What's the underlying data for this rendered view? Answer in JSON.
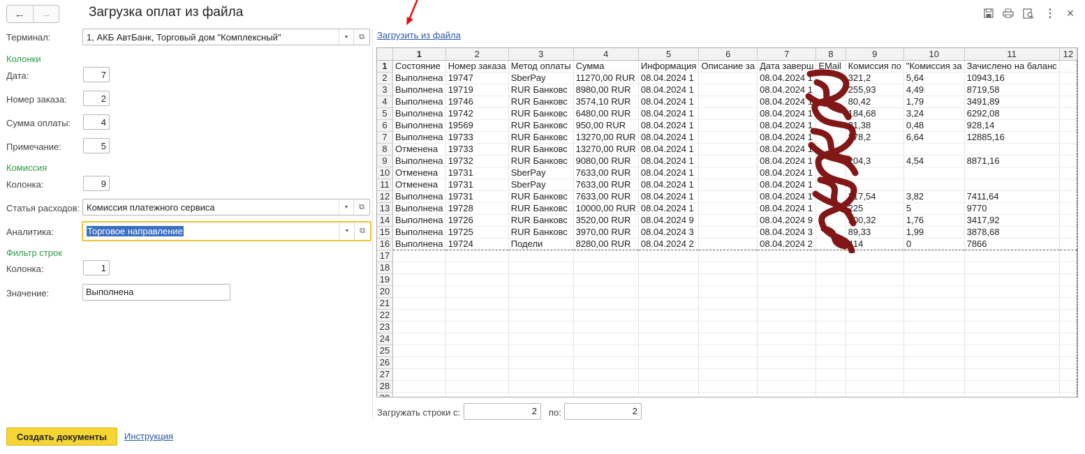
{
  "header": {
    "title": "Загрузка оплат из файла",
    "back_icon": "←",
    "forward_icon": "→",
    "icons": [
      "save-icon",
      "print-icon",
      "preview-icon",
      "more-icon",
      "close-icon"
    ]
  },
  "form": {
    "terminal_label": "Терминал:",
    "terminal_value": "1, АКБ АвтБанк, Торговый дом \"Комплексный\"",
    "columns_section": "Колонки",
    "date_label": "Дата:",
    "date_value": "7",
    "order_label": "Номер заказа:",
    "order_value": "2",
    "sum_label": "Сумма оплаты:",
    "sum_value": "4",
    "note_label": "Примечание:",
    "note_value": "5",
    "commission_section": "Комиссия",
    "commission_col_label": "Колонка:",
    "commission_col_value": "9",
    "expense_label": "Статья расходов:",
    "expense_value": "Комиссия платежного сервиса",
    "analytics_label": "Аналитика:",
    "analytics_value": "Торговое направление",
    "filter_section": "Фильтр строк",
    "filter_col_label": "Колонка:",
    "filter_col_value": "1",
    "filter_value_label": "Значение:",
    "filter_value": "Выполнена"
  },
  "footer": {
    "create_button": "Создать документы",
    "instruction_link": "Инструкция"
  },
  "sheet": {
    "load_link": "Загрузить из файла",
    "col_headers": [
      "1",
      "2",
      "3",
      "4",
      "5",
      "6",
      "7",
      "8",
      "9",
      "10",
      "11",
      "12"
    ],
    "rows": [
      {
        "n": "1",
        "c": [
          "Состояние",
          "Номер заказа",
          "Метод оплаты",
          "Сумма",
          "Информация",
          "Описание за",
          "Дата заверш",
          "EMail",
          "Комиссия по",
          "\"Комиссия за",
          "Зачислено на баланс",
          ""
        ]
      },
      {
        "n": "2",
        "c": [
          "Выполнена",
          "19747",
          "SberPay",
          "11270,00 RUR",
          "08.04.2024 1",
          "",
          "08.04.2024 1",
          "",
          "321,2",
          "5,64",
          "10943,16",
          ""
        ]
      },
      {
        "n": "3",
        "c": [
          "Выполнена",
          "19719",
          "RUR Банковс",
          "8980,00 RUR",
          "08.04.2024 1",
          "",
          "08.04.2024 1",
          "",
          "255,93",
          "4,49",
          "8719,58",
          ""
        ]
      },
      {
        "n": "4",
        "c": [
          "Выполнена",
          "19746",
          "RUR Банковс",
          "3574,10 RUR",
          "08.04.2024 1",
          "",
          "08.04.2024 1",
          "",
          "80,42",
          "1,79",
          "3491,89",
          ""
        ]
      },
      {
        "n": "5",
        "c": [
          "Выполнена",
          "19742",
          "RUR Банковс",
          "6480,00 RUR",
          "08.04.2024 1",
          "",
          "08.04.2024 1",
          "",
          "184,68",
          "3,24",
          "6292,08",
          ""
        ]
      },
      {
        "n": "6",
        "c": [
          "Выполнена",
          "19569",
          "RUR Банковс",
          "950,00 RUR",
          "08.04.2024 1",
          "",
          "08.04.2024 1",
          "",
          "21,38",
          "0,48",
          "928,14",
          ""
        ]
      },
      {
        "n": "7",
        "c": [
          "Выполнена",
          "19733",
          "RUR Банковс",
          "13270,00 RUR",
          "08.04.2024 1",
          "",
          "08.04.2024 1",
          "",
          "378,2",
          "6,64",
          "12885,16",
          ""
        ]
      },
      {
        "n": "8",
        "c": [
          "Отменена",
          "19733",
          "RUR Банковс",
          "13270,00 RUR",
          "08.04.2024 1",
          "",
          "08.04.2024 1",
          "",
          "",
          "",
          "",
          ""
        ]
      },
      {
        "n": "9",
        "c": [
          "Выполнена",
          "19732",
          "RUR Банковс",
          "9080,00 RUR",
          "08.04.2024 1",
          "",
          "08.04.2024 1",
          "",
          "204,3",
          "4,54",
          "8871,16",
          ""
        ]
      },
      {
        "n": "10",
        "c": [
          "Отменена",
          "19731",
          "SberPay",
          "7633,00 RUR",
          "08.04.2024 1",
          "",
          "08.04.2024 1",
          "",
          "",
          "",
          "",
          ""
        ]
      },
      {
        "n": "11",
        "c": [
          "Отменена",
          "19731",
          "SberPay",
          "7633,00 RUR",
          "08.04.2024 1",
          "",
          "08.04.2024 1",
          "",
          "",
          "",
          "",
          ""
        ]
      },
      {
        "n": "12",
        "c": [
          "Выполнена",
          "19731",
          "RUR Банковс",
          "7633,00 RUR",
          "08.04.2024 1",
          "",
          "08.04.2024 1",
          "",
          "217,54",
          "3,82",
          "7411,64",
          ""
        ]
      },
      {
        "n": "13",
        "c": [
          "Выполнена",
          "19728",
          "RUR Банковс",
          "10000,00 RUR",
          "08.04.2024 1",
          "",
          "08.04.2024 1",
          "",
          "225",
          "5",
          "9770",
          ""
        ]
      },
      {
        "n": "14",
        "c": [
          "Выполнена",
          "19726",
          "RUR Банковс",
          "3520,00 RUR",
          "08.04.2024 9",
          "",
          "08.04.2024 9",
          "",
          "100,32",
          "1,76",
          "3417,92",
          ""
        ]
      },
      {
        "n": "15",
        "c": [
          "Выполнена",
          "19725",
          "RUR Банковс",
          "3970,00 RUR",
          "08.04.2024 3",
          "",
          "08.04.2024 3",
          "",
          "89,33",
          "1,99",
          "3878,68",
          ""
        ]
      },
      {
        "n": "16",
        "c": [
          "Выполнена",
          "19724",
          "Подели",
          "8280,00 RUR",
          "08.04.2024 2",
          "",
          "08.04.2024 2",
          "",
          "414",
          "0",
          "7866",
          ""
        ]
      },
      {
        "n": "17",
        "c": [
          "",
          "",
          "",
          "",
          "",
          "",
          "",
          "",
          "",
          "",
          "",
          ""
        ]
      },
      {
        "n": "18",
        "c": [
          "",
          "",
          "",
          "",
          "",
          "",
          "",
          "",
          "",
          "",
          "",
          ""
        ]
      },
      {
        "n": "19",
        "c": [
          "",
          "",
          "",
          "",
          "",
          "",
          "",
          "",
          "",
          "",
          "",
          ""
        ]
      },
      {
        "n": "20",
        "c": [
          "",
          "",
          "",
          "",
          "",
          "",
          "",
          "",
          "",
          "",
          "",
          ""
        ]
      },
      {
        "n": "21",
        "c": [
          "",
          "",
          "",
          "",
          "",
          "",
          "",
          "",
          "",
          "",
          "",
          ""
        ]
      },
      {
        "n": "22",
        "c": [
          "",
          "",
          "",
          "",
          "",
          "",
          "",
          "",
          "",
          "",
          "",
          ""
        ]
      },
      {
        "n": "23",
        "c": [
          "",
          "",
          "",
          "",
          "",
          "",
          "",
          "",
          "",
          "",
          "",
          ""
        ]
      },
      {
        "n": "24",
        "c": [
          "",
          "",
          "",
          "",
          "",
          "",
          "",
          "",
          "",
          "",
          "",
          ""
        ]
      },
      {
        "n": "25",
        "c": [
          "",
          "",
          "",
          "",
          "",
          "",
          "",
          "",
          "",
          "",
          "",
          ""
        ]
      },
      {
        "n": "26",
        "c": [
          "",
          "",
          "",
          "",
          "",
          "",
          "",
          "",
          "",
          "",
          "",
          ""
        ]
      },
      {
        "n": "27",
        "c": [
          "",
          "",
          "",
          "",
          "",
          "",
          "",
          "",
          "",
          "",
          "",
          ""
        ]
      },
      {
        "n": "28",
        "c": [
          "",
          "",
          "",
          "",
          "",
          "",
          "",
          "",
          "",
          "",
          "",
          ""
        ]
      },
      {
        "n": "29",
        "c": [
          "",
          "",
          "",
          "",
          "",
          "",
          "",
          "",
          "",
          "",
          "",
          ""
        ]
      }
    ],
    "load_from_label": "Загружать строки с:",
    "load_from_value": "2",
    "load_to_label": "по:",
    "load_to_value": "2"
  },
  "colors": {
    "section_green": "#2e9a4a",
    "link_blue": "#2a56a8",
    "button_yellow": "#f5d534",
    "focus_yellow": "#f0c430",
    "redaction": "#7a0b0b",
    "annotation_arrow": "#e01010"
  }
}
